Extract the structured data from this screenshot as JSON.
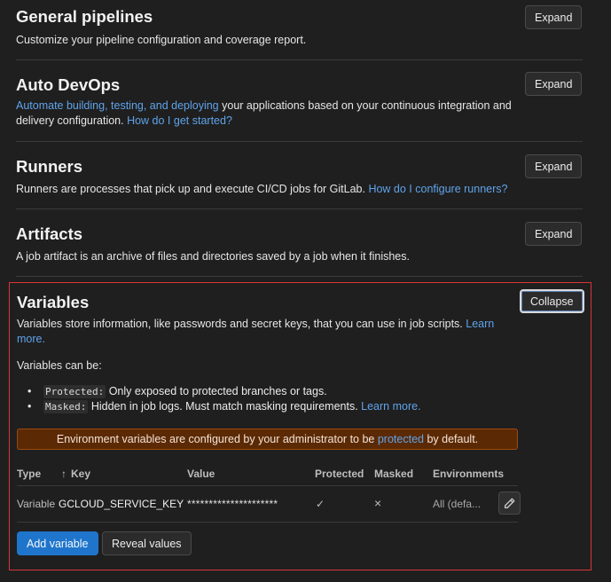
{
  "sections": {
    "general": {
      "title": "General pipelines",
      "desc": "Customize your pipeline configuration and coverage report.",
      "button": "Expand"
    },
    "autodevops": {
      "title": "Auto DevOps",
      "link1": "Automate building, testing, and deploying",
      "desc_mid": " your applications based on your continuous integration and delivery configuration. ",
      "link2": "How do I get started?",
      "button": "Expand"
    },
    "runners": {
      "title": "Runners",
      "desc": "Runners are processes that pick up and execute CI/CD jobs for GitLab. ",
      "link": "How do I configure runners?",
      "button": "Expand"
    },
    "artifacts": {
      "title": "Artifacts",
      "desc": "A job artifact is an archive of files and directories saved by a job when it finishes.",
      "button": "Expand"
    }
  },
  "variables": {
    "title": "Variables",
    "button": "Collapse",
    "desc": "Variables store information, like passwords and secret keys, that you can use in job scripts. ",
    "learn_more": "Learn more.",
    "can_be": "Variables can be:",
    "items": [
      {
        "code": "Protected:",
        "text": " Only exposed to protected branches or tags.",
        "link": ""
      },
      {
        "code": "Masked:",
        "text": " Hidden in job logs. Must match masking requirements. ",
        "link": "Learn more."
      }
    ],
    "alert_pre": "Environment variables are configured by your administrator to be ",
    "alert_link": "protected",
    "alert_post": " by default.",
    "table": {
      "headers": {
        "type": "Type",
        "sort": "↑",
        "key": "Key",
        "value": "Value",
        "protected": "Protected",
        "masked": "Masked",
        "environments": "Environments"
      },
      "rows": [
        {
          "type": "Variable",
          "key": "GCLOUD_SERVICE_KEY",
          "value": "*********************",
          "protected": "✓",
          "masked": "×",
          "environments": "All (defa..."
        }
      ]
    },
    "add_button": "Add variable",
    "reveal_button": "Reveal values"
  }
}
